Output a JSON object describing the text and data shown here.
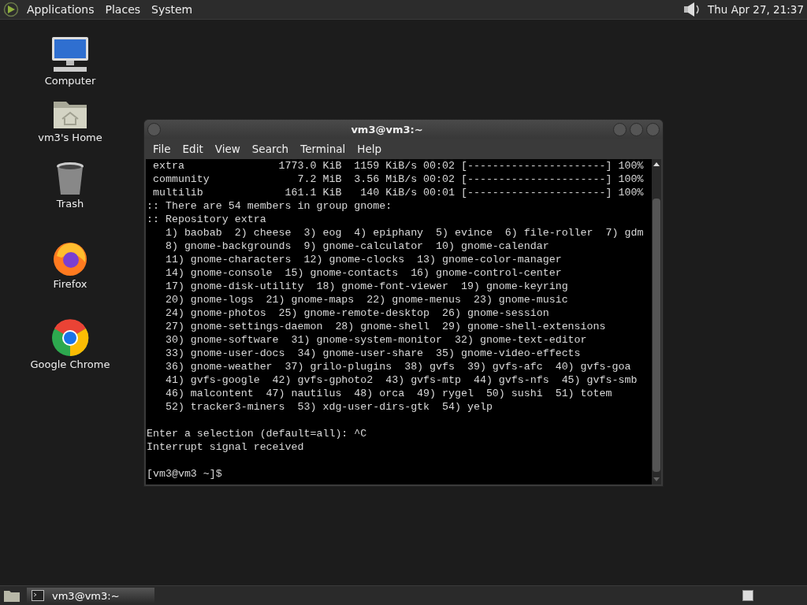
{
  "top_panel": {
    "menus": [
      "Applications",
      "Places",
      "System"
    ],
    "clock": "Thu Apr 27, 21:37"
  },
  "desktop_icons": [
    {
      "kind": "computer",
      "label": "Computer"
    },
    {
      "kind": "home",
      "label": "vm3's Home"
    },
    {
      "kind": "trash",
      "label": "Trash"
    },
    {
      "kind": "firefox",
      "label": "Firefox"
    },
    {
      "kind": "chrome",
      "label": "Google Chrome"
    }
  ],
  "terminal": {
    "title": "vm3@vm3:~",
    "menus": [
      "File",
      "Edit",
      "View",
      "Search",
      "Terminal",
      "Help"
    ],
    "blocks": [
      [
        " extra               1773.0 KiB  1159 KiB/s 00:02 [----------------------] 100%",
        " community              7.2 MiB  3.56 MiB/s 00:02 [----------------------] 100%",
        " multilib             161.1 KiB   140 KiB/s 00:01 [----------------------] 100%",
        ":: There are 54 members in group gnome:",
        ":: Repository extra",
        "   1) baobab  2) cheese  3) eog  4) epiphany  5) evince  6) file-roller  7) gdm",
        "   8) gnome-backgrounds  9) gnome-calculator  10) gnome-calendar",
        "   11) gnome-characters  12) gnome-clocks  13) gnome-color-manager",
        "   14) gnome-console  15) gnome-contacts  16) gnome-control-center",
        "   17) gnome-disk-utility  18) gnome-font-viewer  19) gnome-keyring",
        "   20) gnome-logs  21) gnome-maps  22) gnome-menus  23) gnome-music",
        "   24) gnome-photos  25) gnome-remote-desktop  26) gnome-session",
        "   27) gnome-settings-daemon  28) gnome-shell  29) gnome-shell-extensions",
        "   30) gnome-software  31) gnome-system-monitor  32) gnome-text-editor",
        "   33) gnome-user-docs  34) gnome-user-share  35) gnome-video-effects",
        "   36) gnome-weather  37) grilo-plugins  38) gvfs  39) gvfs-afc  40) gvfs-goa",
        "   41) gvfs-google  42) gvfs-gphoto2  43) gvfs-mtp  44) gvfs-nfs  45) gvfs-smb",
        "   46) malcontent  47) nautilus  48) orca  49) rygel  50) sushi  51) totem",
        "   52) tracker3-miners  53) xdg-user-dirs-gtk  54) yelp"
      ],
      [
        "Enter a selection (default=all): ^C",
        "Interrupt signal received"
      ],
      [
        "[vm3@vm3 ~]$"
      ]
    ]
  },
  "taskbar": {
    "tasks": [
      {
        "label": "vm3@vm3:~",
        "selected": true
      }
    ]
  }
}
